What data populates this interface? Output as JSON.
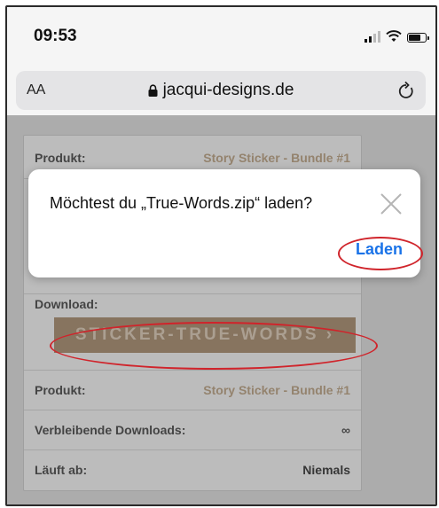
{
  "status_bar": {
    "time": "09:53"
  },
  "address_bar": {
    "text_size": "AA",
    "url": "jacqui-designs.de"
  },
  "order": {
    "product_label": "Produkt:",
    "product_value": "Story Sticker - Bundle #1",
    "download_label": "Download:",
    "download_button": "STICKER-TRUE-WORDS  ›",
    "product2_label": "Produkt:",
    "product2_value": "Story Sticker - Bundle #1",
    "remaining_label": "Verbleibende Downloads:",
    "remaining_value": "∞",
    "expires_label": "Läuft ab:",
    "expires_value": "Niemals"
  },
  "dialog": {
    "message": "Möchtest du „True-Words.zip“ laden?",
    "load_button": "Laden"
  },
  "colors": {
    "annotation": "#d0242b",
    "link": "#1a73e8",
    "button": "#a99277"
  }
}
